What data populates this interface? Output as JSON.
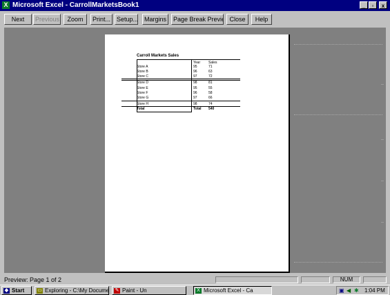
{
  "window": {
    "title": "Microsoft Excel - CarrollMarketsBook1",
    "minimize_glyph": "_",
    "restore_glyph": "▫",
    "close_glyph": "x"
  },
  "toolbar": {
    "buttons": [
      {
        "label": "Next",
        "enabled": true
      },
      {
        "label": "Previous",
        "enabled": false
      },
      {
        "label": "Zoom",
        "enabled": true
      },
      {
        "label": "Print...",
        "enabled": true
      },
      {
        "label": "Setup...",
        "enabled": true
      },
      {
        "label": "Margins",
        "enabled": true
      },
      {
        "label": "Page Break Preview",
        "enabled": true
      },
      {
        "label": "Close",
        "enabled": true
      },
      {
        "label": "Help",
        "enabled": true
      }
    ]
  },
  "page_preview": {
    "title": "Carroll Markets Sales",
    "columns": [
      "Year",
      "Sales"
    ],
    "rows": [
      {
        "label": "Store A",
        "v1": "95",
        "v2": "71"
      },
      {
        "label": "Store B",
        "v1": "96",
        "v2": "63"
      },
      {
        "label": "Store C",
        "v1": "97",
        "v2": "72"
      },
      {
        "label": "Store D",
        "v1": "98",
        "v2": "81"
      },
      {
        "label": "Store E",
        "v1": "95",
        "v2": "55"
      },
      {
        "label": "Store F",
        "v1": "96",
        "v2": "58"
      },
      {
        "label": "Store G",
        "v1": "97",
        "v2": "66"
      },
      {
        "label": "Store H",
        "v1": "98",
        "v2": "74"
      },
      {
        "label": "Total",
        "v1": "Total",
        "v2": "540"
      }
    ]
  },
  "status": {
    "text": "Preview: Page 1 of 2",
    "num": "NUM"
  },
  "taskbar": {
    "start": "Start",
    "tasks": [
      {
        "label": "Exploring - C:\\My Documents",
        "icon_color": "#808000"
      },
      {
        "label": "Paint - Un",
        "icon_color": "#c00000"
      },
      {
        "label": "Microsoft Excel - Ca",
        "icon_color": "#0a7a2a",
        "active": true
      }
    ],
    "clock": "1:04 PM"
  }
}
